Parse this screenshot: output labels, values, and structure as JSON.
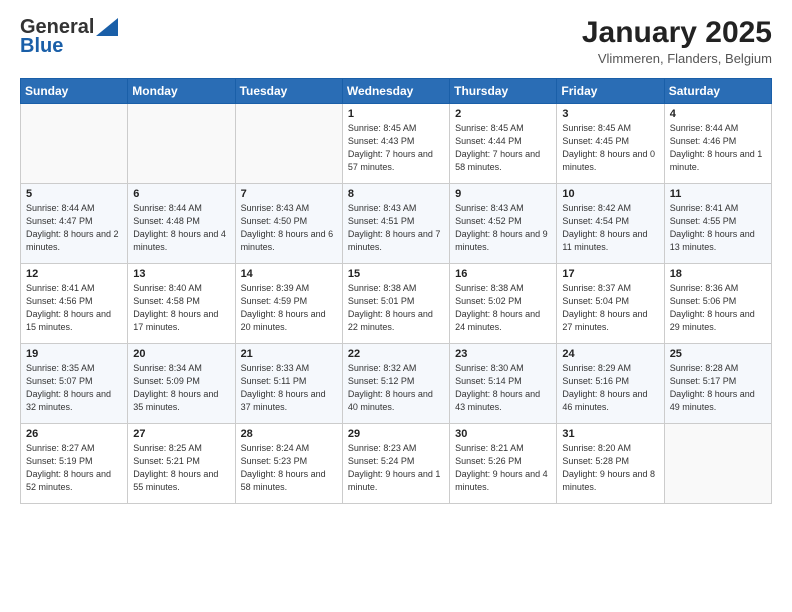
{
  "header": {
    "logo_general": "General",
    "logo_blue": "Blue",
    "month_title": "January 2025",
    "location": "Vlimmeren, Flanders, Belgium"
  },
  "weekdays": [
    "Sunday",
    "Monday",
    "Tuesday",
    "Wednesday",
    "Thursday",
    "Friday",
    "Saturday"
  ],
  "weeks": [
    [
      {
        "day": "",
        "text": ""
      },
      {
        "day": "",
        "text": ""
      },
      {
        "day": "",
        "text": ""
      },
      {
        "day": "1",
        "text": "Sunrise: 8:45 AM\nSunset: 4:43 PM\nDaylight: 7 hours and 57 minutes."
      },
      {
        "day": "2",
        "text": "Sunrise: 8:45 AM\nSunset: 4:44 PM\nDaylight: 7 hours and 58 minutes."
      },
      {
        "day": "3",
        "text": "Sunrise: 8:45 AM\nSunset: 4:45 PM\nDaylight: 8 hours and 0 minutes."
      },
      {
        "day": "4",
        "text": "Sunrise: 8:44 AM\nSunset: 4:46 PM\nDaylight: 8 hours and 1 minute."
      }
    ],
    [
      {
        "day": "5",
        "text": "Sunrise: 8:44 AM\nSunset: 4:47 PM\nDaylight: 8 hours and 2 minutes."
      },
      {
        "day": "6",
        "text": "Sunrise: 8:44 AM\nSunset: 4:48 PM\nDaylight: 8 hours and 4 minutes."
      },
      {
        "day": "7",
        "text": "Sunrise: 8:43 AM\nSunset: 4:50 PM\nDaylight: 8 hours and 6 minutes."
      },
      {
        "day": "8",
        "text": "Sunrise: 8:43 AM\nSunset: 4:51 PM\nDaylight: 8 hours and 7 minutes."
      },
      {
        "day": "9",
        "text": "Sunrise: 8:43 AM\nSunset: 4:52 PM\nDaylight: 8 hours and 9 minutes."
      },
      {
        "day": "10",
        "text": "Sunrise: 8:42 AM\nSunset: 4:54 PM\nDaylight: 8 hours and 11 minutes."
      },
      {
        "day": "11",
        "text": "Sunrise: 8:41 AM\nSunset: 4:55 PM\nDaylight: 8 hours and 13 minutes."
      }
    ],
    [
      {
        "day": "12",
        "text": "Sunrise: 8:41 AM\nSunset: 4:56 PM\nDaylight: 8 hours and 15 minutes."
      },
      {
        "day": "13",
        "text": "Sunrise: 8:40 AM\nSunset: 4:58 PM\nDaylight: 8 hours and 17 minutes."
      },
      {
        "day": "14",
        "text": "Sunrise: 8:39 AM\nSunset: 4:59 PM\nDaylight: 8 hours and 20 minutes."
      },
      {
        "day": "15",
        "text": "Sunrise: 8:38 AM\nSunset: 5:01 PM\nDaylight: 8 hours and 22 minutes."
      },
      {
        "day": "16",
        "text": "Sunrise: 8:38 AM\nSunset: 5:02 PM\nDaylight: 8 hours and 24 minutes."
      },
      {
        "day": "17",
        "text": "Sunrise: 8:37 AM\nSunset: 5:04 PM\nDaylight: 8 hours and 27 minutes."
      },
      {
        "day": "18",
        "text": "Sunrise: 8:36 AM\nSunset: 5:06 PM\nDaylight: 8 hours and 29 minutes."
      }
    ],
    [
      {
        "day": "19",
        "text": "Sunrise: 8:35 AM\nSunset: 5:07 PM\nDaylight: 8 hours and 32 minutes."
      },
      {
        "day": "20",
        "text": "Sunrise: 8:34 AM\nSunset: 5:09 PM\nDaylight: 8 hours and 35 minutes."
      },
      {
        "day": "21",
        "text": "Sunrise: 8:33 AM\nSunset: 5:11 PM\nDaylight: 8 hours and 37 minutes."
      },
      {
        "day": "22",
        "text": "Sunrise: 8:32 AM\nSunset: 5:12 PM\nDaylight: 8 hours and 40 minutes."
      },
      {
        "day": "23",
        "text": "Sunrise: 8:30 AM\nSunset: 5:14 PM\nDaylight: 8 hours and 43 minutes."
      },
      {
        "day": "24",
        "text": "Sunrise: 8:29 AM\nSunset: 5:16 PM\nDaylight: 8 hours and 46 minutes."
      },
      {
        "day": "25",
        "text": "Sunrise: 8:28 AM\nSunset: 5:17 PM\nDaylight: 8 hours and 49 minutes."
      }
    ],
    [
      {
        "day": "26",
        "text": "Sunrise: 8:27 AM\nSunset: 5:19 PM\nDaylight: 8 hours and 52 minutes."
      },
      {
        "day": "27",
        "text": "Sunrise: 8:25 AM\nSunset: 5:21 PM\nDaylight: 8 hours and 55 minutes."
      },
      {
        "day": "28",
        "text": "Sunrise: 8:24 AM\nSunset: 5:23 PM\nDaylight: 8 hours and 58 minutes."
      },
      {
        "day": "29",
        "text": "Sunrise: 8:23 AM\nSunset: 5:24 PM\nDaylight: 9 hours and 1 minute."
      },
      {
        "day": "30",
        "text": "Sunrise: 8:21 AM\nSunset: 5:26 PM\nDaylight: 9 hours and 4 minutes."
      },
      {
        "day": "31",
        "text": "Sunrise: 8:20 AM\nSunset: 5:28 PM\nDaylight: 9 hours and 8 minutes."
      },
      {
        "day": "",
        "text": ""
      }
    ]
  ]
}
